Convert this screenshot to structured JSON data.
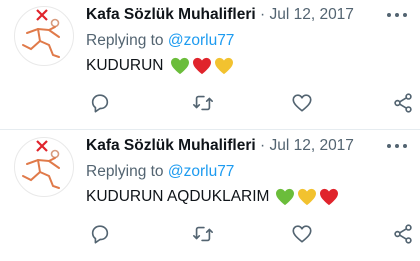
{
  "tweets": [
    {
      "author": "Kafa Sözlük Muhalifleri",
      "separator": "·",
      "date": "Jul 12, 2017",
      "replying_prefix": "Replying to",
      "replying_handle": "@zorlu77",
      "text": "KUDURUN",
      "hearts": [
        "#6bbd3b",
        "#e0242c",
        "#f2c22f"
      ]
    },
    {
      "author": "Kafa Sözlük Muhalifleri",
      "separator": "·",
      "date": "Jul 12, 2017",
      "replying_prefix": "Replying to",
      "replying_handle": "@zorlu77",
      "text": "KUDURUN AQDUKLARIM",
      "hearts": [
        "#6bbd3b",
        "#f2c22f",
        "#e0242c"
      ]
    }
  ],
  "icons": {
    "more": "more-horizontal-icon",
    "reply": "reply-bubble-icon",
    "retweet": "retweet-icon",
    "like": "heart-outline-icon",
    "share": "share-icon"
  },
  "colors": {
    "text": "#0f1419",
    "muted": "#536471",
    "link": "#1d9bf0",
    "avatar_accent": "#e0242c"
  }
}
